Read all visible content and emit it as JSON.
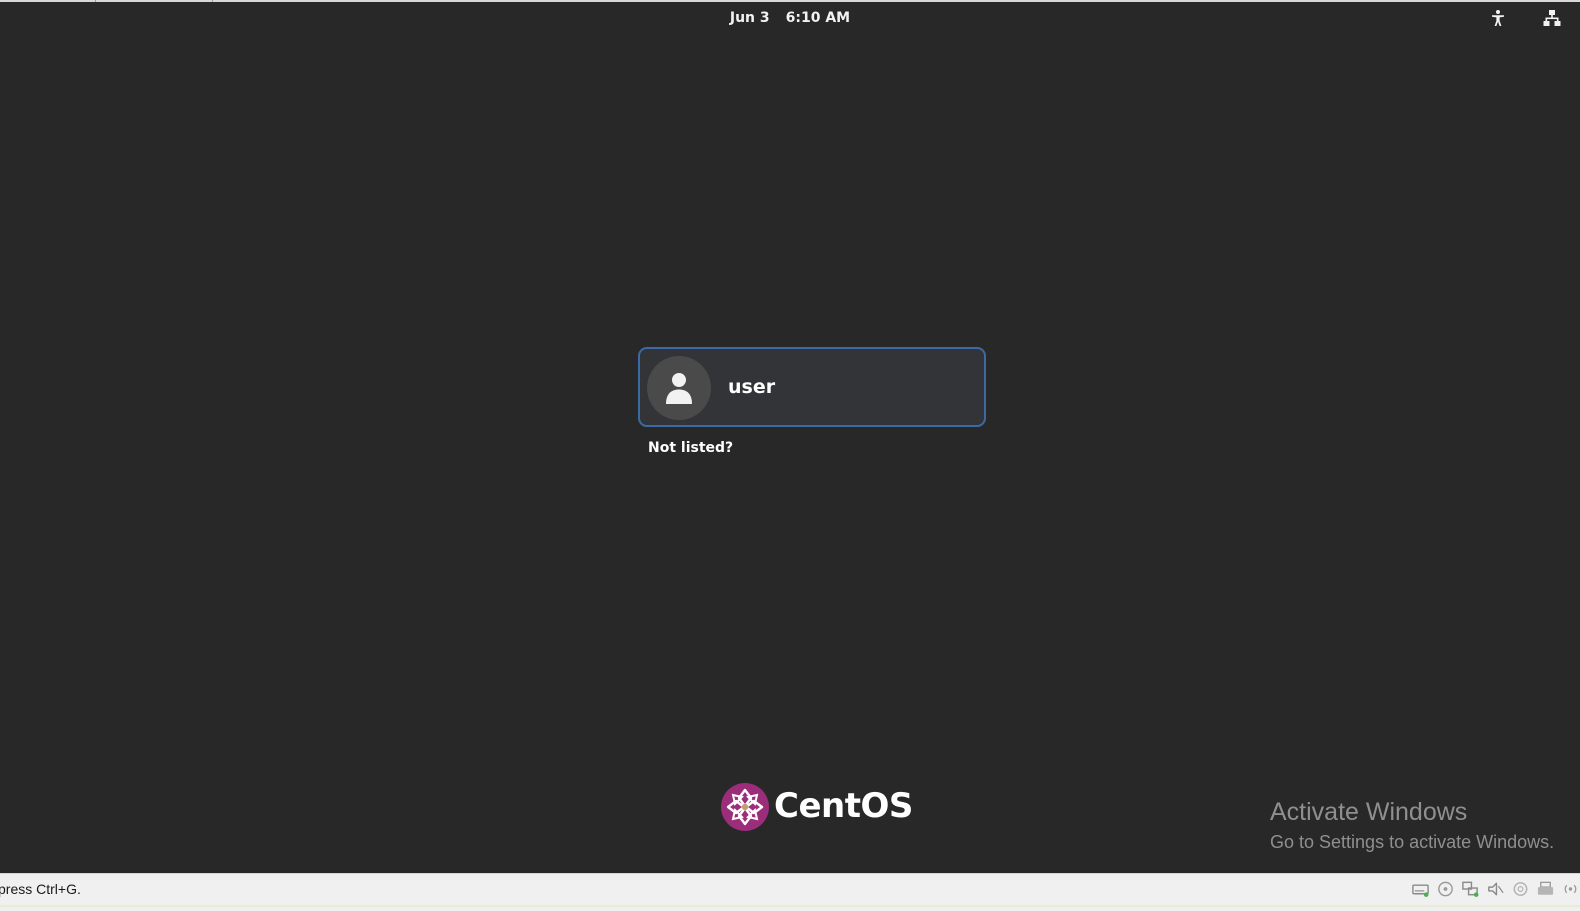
{
  "top_bar": {
    "date": "Jun 3",
    "time": "6:10 AM",
    "icons": [
      "accessibility-icon",
      "network-icon"
    ]
  },
  "login": {
    "user_name": "user",
    "not_listed_label": "Not listed?"
  },
  "branding": {
    "logo_text": "CentOS",
    "logo_colors": [
      "#9b2d7b",
      "#c0a06b"
    ]
  },
  "watermark": {
    "title": "Activate Windows",
    "subtitle": "Go to Settings to activate Windows."
  },
  "status_bar": {
    "hint_text": "press Ctrl+G.",
    "icons": [
      "hard-disk-icon",
      "optical-drive-icon",
      "network-adapter-icon",
      "audio-icon",
      "usb-icon",
      "printer-icon",
      "remote-display-icon"
    ]
  },
  "colors": {
    "background": "#282828",
    "card": "#323437",
    "card_border": "#3b6aa5",
    "status_bar": "#f0f0f0"
  }
}
